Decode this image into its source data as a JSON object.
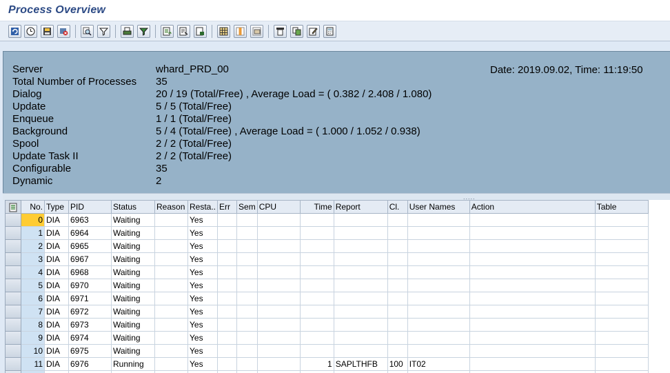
{
  "window": {
    "title": "Process Overview"
  },
  "toolbar": {
    "buttons": [
      {
        "name": "refresh-icon"
      },
      {
        "name": "clock-icon"
      },
      {
        "name": "save-icon"
      },
      {
        "name": "stop-icon"
      },
      {
        "name": "find-icon"
      },
      {
        "name": "filter-icon"
      },
      {
        "name": "print-icon"
      },
      {
        "name": "sort-filter-icon"
      },
      {
        "name": "export-icon"
      },
      {
        "name": "detail-icon"
      },
      {
        "name": "local-file-icon"
      },
      {
        "name": "grid-layout-icon"
      },
      {
        "name": "column-icon"
      },
      {
        "name": "subtotal-icon"
      },
      {
        "name": "change-layout-icon"
      },
      {
        "name": "copy-icon"
      },
      {
        "name": "edit-icon"
      },
      {
        "name": "calculator-icon"
      }
    ]
  },
  "info": {
    "date_time": "Date: 2019.09.02, Time: 11:19:50",
    "rows": [
      {
        "label": "Server",
        "value": "whard_PRD_00"
      },
      {
        "label": "Total Number of Processes",
        "value": "35"
      },
      {
        "label": "Dialog",
        "value": "20 / 19 (Total/Free) , Average Load = ( 0.382 / 2.408 / 1.080)"
      },
      {
        "label": "Update",
        "value": "5 / 5 (Total/Free)"
      },
      {
        "label": "Enqueue",
        "value": "1 / 1 (Total/Free)"
      },
      {
        "label": "Background",
        "value": "5 / 4 (Total/Free) , Average Load = ( 1.000 / 1.052 / 0.938)"
      },
      {
        "label": "Spool",
        "value": "2 / 2 (Total/Free)"
      },
      {
        "label": "Update Task II",
        "value": "2 / 2 (Total/Free)"
      },
      {
        "label": "Configurable",
        "value": "35"
      },
      {
        "label": "Dynamic",
        "value": "2"
      }
    ]
  },
  "splitter": {
    "grip": "....."
  },
  "grid": {
    "columns": [
      "No.",
      "Type",
      "PID",
      "Status",
      "Reason",
      "Resta..",
      "Err",
      "Sem",
      "CPU",
      "Time",
      "Report",
      "Cl.",
      "User Names",
      "Action",
      "Table"
    ],
    "rows": [
      [
        "0",
        "DIA",
        "6963",
        "Waiting",
        "",
        "Yes",
        "",
        "",
        "",
        "",
        "",
        "",
        "",
        "",
        ""
      ],
      [
        "1",
        "DIA",
        "6964",
        "Waiting",
        "",
        "Yes",
        "",
        "",
        "",
        "",
        "",
        "",
        "",
        "",
        ""
      ],
      [
        "2",
        "DIA",
        "6965",
        "Waiting",
        "",
        "Yes",
        "",
        "",
        "",
        "",
        "",
        "",
        "",
        "",
        ""
      ],
      [
        "3",
        "DIA",
        "6967",
        "Waiting",
        "",
        "Yes",
        "",
        "",
        "",
        "",
        "",
        "",
        "",
        "",
        ""
      ],
      [
        "4",
        "DIA",
        "6968",
        "Waiting",
        "",
        "Yes",
        "",
        "",
        "",
        "",
        "",
        "",
        "",
        "",
        ""
      ],
      [
        "5",
        "DIA",
        "6970",
        "Waiting",
        "",
        "Yes",
        "",
        "",
        "",
        "",
        "",
        "",
        "",
        "",
        ""
      ],
      [
        "6",
        "DIA",
        "6971",
        "Waiting",
        "",
        "Yes",
        "",
        "",
        "",
        "",
        "",
        "",
        "",
        "",
        ""
      ],
      [
        "7",
        "DIA",
        "6972",
        "Waiting",
        "",
        "Yes",
        "",
        "",
        "",
        "",
        "",
        "",
        "",
        "",
        ""
      ],
      [
        "8",
        "DIA",
        "6973",
        "Waiting",
        "",
        "Yes",
        "",
        "",
        "",
        "",
        "",
        "",
        "",
        "",
        ""
      ],
      [
        "9",
        "DIA",
        "6974",
        "Waiting",
        "",
        "Yes",
        "",
        "",
        "",
        "",
        "",
        "",
        "",
        "",
        ""
      ],
      [
        "10",
        "DIA",
        "6975",
        "Waiting",
        "",
        "Yes",
        "",
        "",
        "",
        "",
        "",
        "",
        "",
        "",
        ""
      ],
      [
        "11",
        "DIA",
        "6976",
        "Running",
        "",
        "Yes",
        "",
        "",
        "",
        "1",
        "SAPLTHFB",
        "100",
        "IT02",
        "",
        ""
      ],
      [
        "",
        "",
        "",
        "",
        "",
        "",
        "",
        "",
        "",
        "",
        "",
        "",
        "",
        "",
        ""
      ]
    ]
  }
}
